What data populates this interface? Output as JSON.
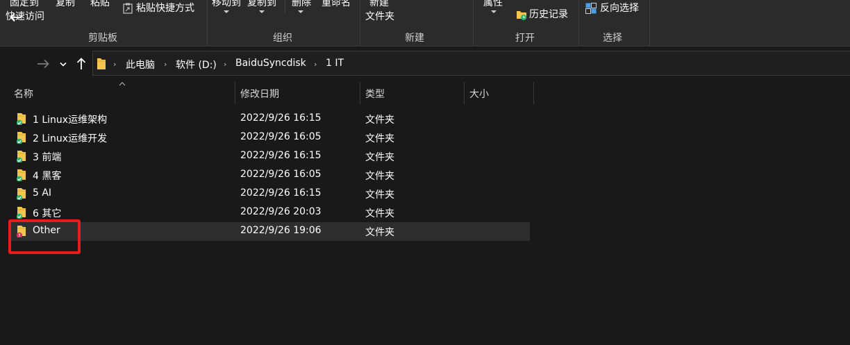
{
  "ribbon": {
    "pin_label_line1": "固定到",
    "pin_label_line2": "快速访问",
    "copy_label": "复制",
    "paste_label": "粘贴",
    "paste_shortcut_label": "粘贴快捷方式",
    "move_to_label": "移动到",
    "copy_to_label": "复制到",
    "delete_label": "删除",
    "rename_label": "重命名",
    "new_folder_line1": "新建",
    "new_folder_line2": "文件夹",
    "properties_label": "属性",
    "history_label": "历史记录",
    "invert_select_label": "反向选择",
    "groups": {
      "clipboard": "剪贴板",
      "organize": "组织",
      "new": "新建",
      "open": "打开",
      "select": "选择"
    }
  },
  "address": {
    "crumbs": [
      "此电脑",
      "软件 (D:)",
      "BaiduSyncdisk",
      "1 IT"
    ]
  },
  "columns": {
    "name": "名称",
    "modified": "修改日期",
    "type": "类型",
    "size": "大小"
  },
  "rows": [
    {
      "name": "1 Linux运维架构",
      "modified": "2022/9/26 16:15",
      "type": "文件夹",
      "status": "synced"
    },
    {
      "name": "2 Linux运维开发",
      "modified": "2022/9/26 16:05",
      "type": "文件夹",
      "status": "synced"
    },
    {
      "name": "3 前端",
      "modified": "2022/9/26 16:15",
      "type": "文件夹",
      "status": "synced"
    },
    {
      "name": "4 黑客",
      "modified": "2022/9/26 16:05",
      "type": "文件夹",
      "status": "synced"
    },
    {
      "name": "5 AI",
      "modified": "2022/9/26 16:15",
      "type": "文件夹",
      "status": "synced"
    },
    {
      "name": "6 其它",
      "modified": "2022/9/26 20:03",
      "type": "文件夹",
      "status": "synced"
    },
    {
      "name": "Other",
      "modified": "2022/9/26 19:06",
      "type": "文件夹",
      "status": "error"
    }
  ],
  "colors": {
    "folder": "#f3c74f",
    "synced_badge": "#2fb46f",
    "error_badge": "#e0315a",
    "highlight": "#e81c1c"
  }
}
